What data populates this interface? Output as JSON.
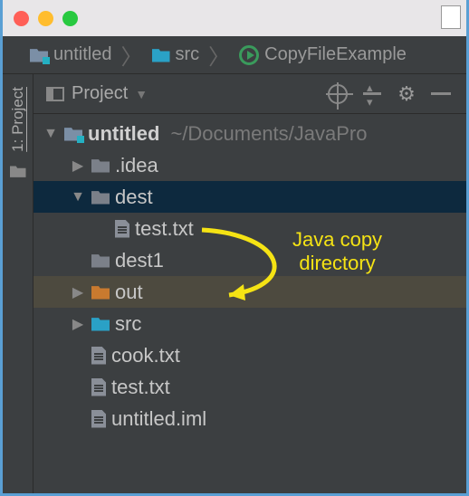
{
  "breadcrumb": {
    "root": "untitled",
    "src": "src",
    "file": "CopyFileExample"
  },
  "gutter": {
    "label": "1: Project"
  },
  "toolbar": {
    "view_label": "Project"
  },
  "tree": {
    "root": {
      "name": "untitled",
      "path": "~/Documents/JavaPro"
    },
    "idea": ".idea",
    "dest": "dest",
    "dest_test": "test.txt",
    "dest1": "dest1",
    "out": "out",
    "src": "src",
    "cook": "cook.txt",
    "test": "test.txt",
    "iml": "untitled.iml"
  },
  "annotation": {
    "line1": "Java copy",
    "line2": "directory"
  }
}
